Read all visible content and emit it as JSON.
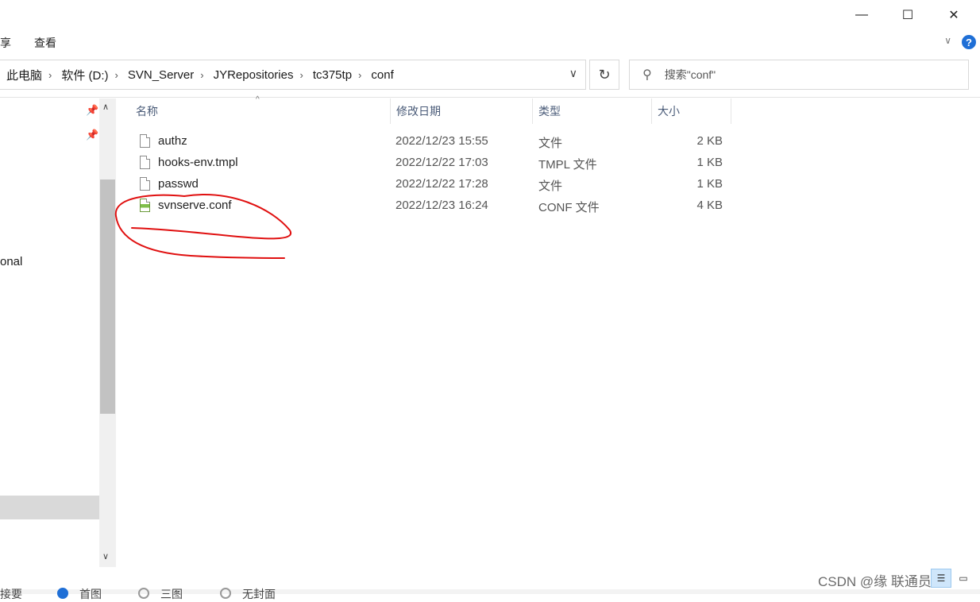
{
  "window": {
    "minimize_glyph": "—",
    "maximize_glyph": "☐",
    "close_glyph": "✕"
  },
  "ribbon": {
    "tabs": [
      "享",
      "查看"
    ],
    "expand_glyph": "∨",
    "help_glyph": "?"
  },
  "address_bar": {
    "crumbs": [
      "此电脑",
      "软件 (D:)",
      "SVN_Server",
      "JYRepositories",
      "tc375tp",
      "conf"
    ],
    "separator": "›",
    "dropdown_glyph": "∨",
    "refresh_glyph": "↻"
  },
  "search": {
    "placeholder": "搜索\"conf\"",
    "icon": "search-icon"
  },
  "nav_pane": {
    "partial_item": "onal",
    "pin_icon": "pin-icon",
    "scroll_up": "∧",
    "scroll_down": "∨"
  },
  "columns": {
    "name": "名称",
    "modified": "修改日期",
    "type": "类型",
    "size": "大小",
    "sort_glyph": "^"
  },
  "files": [
    {
      "name": "authz",
      "modified": "2022/12/23 15:55",
      "type": "文件",
      "size": "2 KB",
      "icon": "file-icon"
    },
    {
      "name": "hooks-env.tmpl",
      "modified": "2022/12/22 17:03",
      "type": "TMPL 文件",
      "size": "1 KB",
      "icon": "file-icon"
    },
    {
      "name": "passwd",
      "modified": "2022/12/22 17:28",
      "type": "文件",
      "size": "1 KB",
      "icon": "file-icon"
    },
    {
      "name": "svnserve.conf",
      "modified": "2022/12/23 16:24",
      "type": "CONF 文件",
      "size": "4 KB",
      "icon": "conf-file-icon"
    }
  ],
  "bottom": {
    "partial_texts": [
      "接要",
      "首图",
      "三图",
      "无封面"
    ],
    "watermark": "CSDN @缘    联通员工"
  },
  "colors": {
    "accent": "#1f6fd6",
    "annotation": "#e01010",
    "header_text": "#4a5b78"
  }
}
